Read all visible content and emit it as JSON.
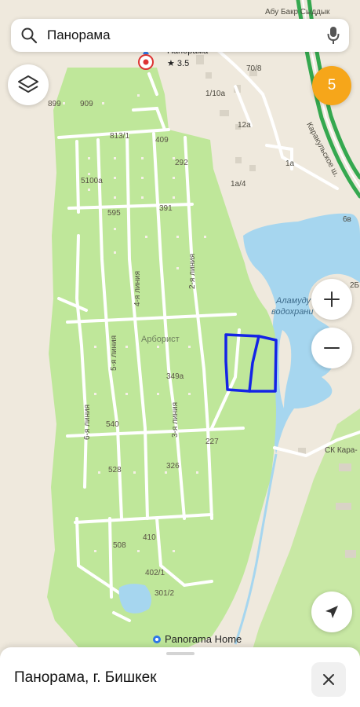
{
  "search": {
    "query": "Панорама"
  },
  "traffic": {
    "level": "5"
  },
  "place": {
    "name": "Панорама",
    "rating": "★ 3.5"
  },
  "map_labels": {
    "abu_bakr": "Абу Бакр Сыддык",
    "n70_8": "70/8",
    "n1_10a": "1/10а",
    "n12a": "12а",
    "n1a": "1а",
    "n1a_4": "1а/4",
    "n6v": "6в",
    "n2b": "2Б",
    "n899": "899",
    "n909": "909",
    "n813_1": "813/1",
    "n409": "409",
    "n292": "292",
    "n5100a": "5100а",
    "n595": "595",
    "n391": "391",
    "n349a": "349а",
    "n540": "540",
    "n227": "227",
    "n528": "528",
    "n326": "326",
    "n508": "508",
    "n410": "410",
    "n402_1": "402/1",
    "n301_2": "301/2",
    "arboretum": "Арборист",
    "reservoir_1": "Аламуду",
    "reservoir_2": "водохрани",
    "highway": "Каракульское ш.",
    "sk_kara": "СК Кара-",
    "line2": "2-я линия",
    "line3": "3-я линия",
    "line4": "4-я линия",
    "line5": "5-я линия",
    "line6": "6-я линия",
    "panorama_home": "Panorama Home"
  },
  "sheet": {
    "title": "Панорама, г. Бишкек"
  },
  "colors": {
    "park": "#bfe79a",
    "road": "#ffffff",
    "water": "#a6d6ef",
    "highway": "#35a84f",
    "traffic_badge": "#f6a61a",
    "drawn_outline": "#1424e6",
    "accent": "#2f78e8"
  }
}
